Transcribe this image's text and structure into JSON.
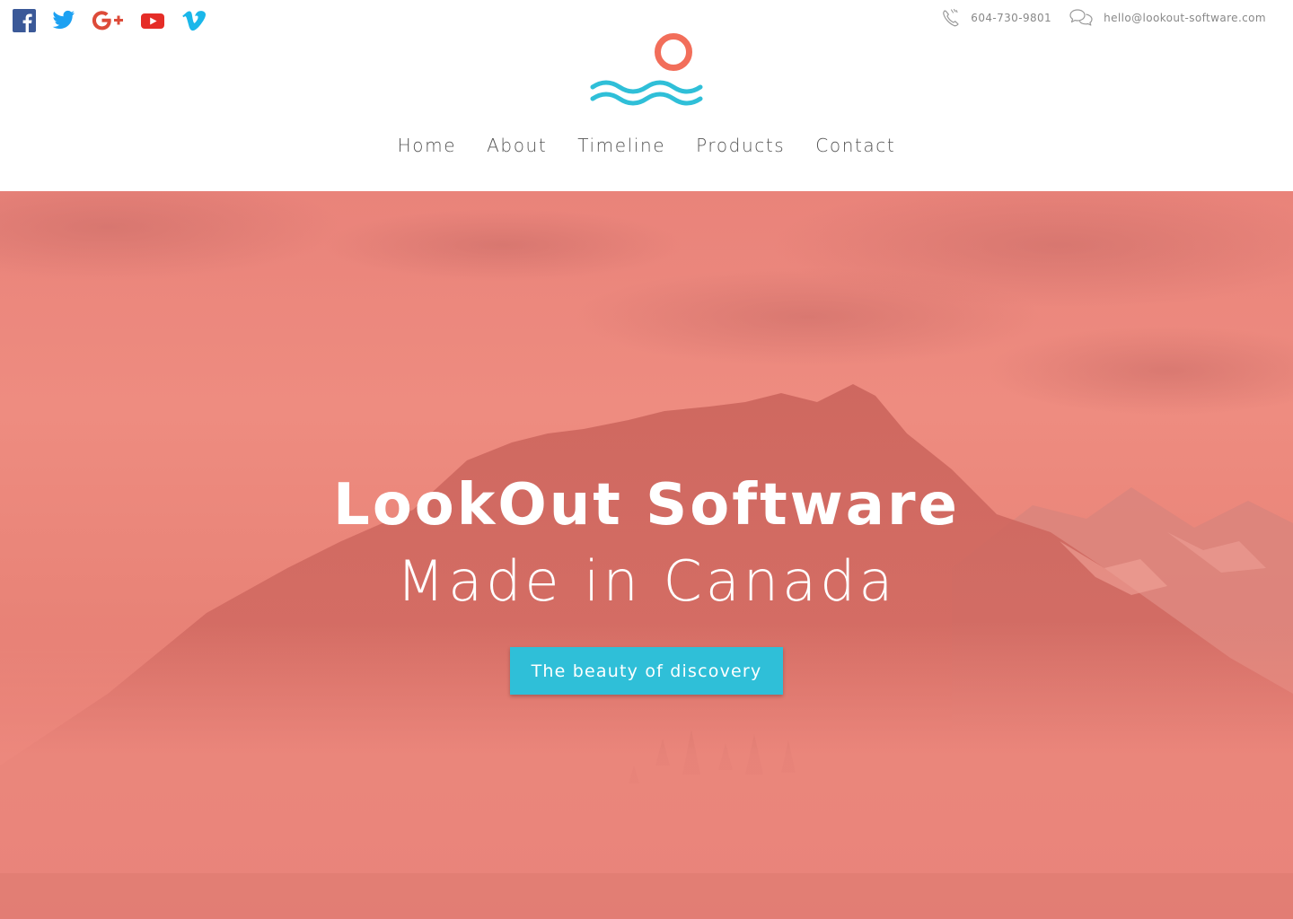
{
  "header": {
    "social": [
      {
        "name": "facebook-icon",
        "color": "#3b5998"
      },
      {
        "name": "twitter-icon",
        "color": "#1da1f2"
      },
      {
        "name": "google-plus-icon",
        "color": "#dd4b39"
      },
      {
        "name": "youtube-icon",
        "color": "#e52d27"
      },
      {
        "name": "vimeo-icon",
        "color": "#1ab7ea"
      }
    ],
    "phone": "604-730-9801",
    "email": "hello@lookout-software.com",
    "contact_icons": [
      "phone-icon",
      "chat-icon"
    ]
  },
  "logo": {
    "name": "sun-waves-logo",
    "sun_color": "#f26e5a",
    "wave_color": "#2fbfd8"
  },
  "nav": {
    "items": [
      {
        "label": "Home"
      },
      {
        "label": "About"
      },
      {
        "label": "Timeline"
      },
      {
        "label": "Products"
      },
      {
        "label": "Contact"
      }
    ]
  },
  "hero": {
    "title": "LookOut Software",
    "subtitle": "Made in Canada",
    "cta_label": "The beauty of discovery",
    "overlay_color": "#ec8377",
    "cta_color": "#2fbfd8"
  }
}
